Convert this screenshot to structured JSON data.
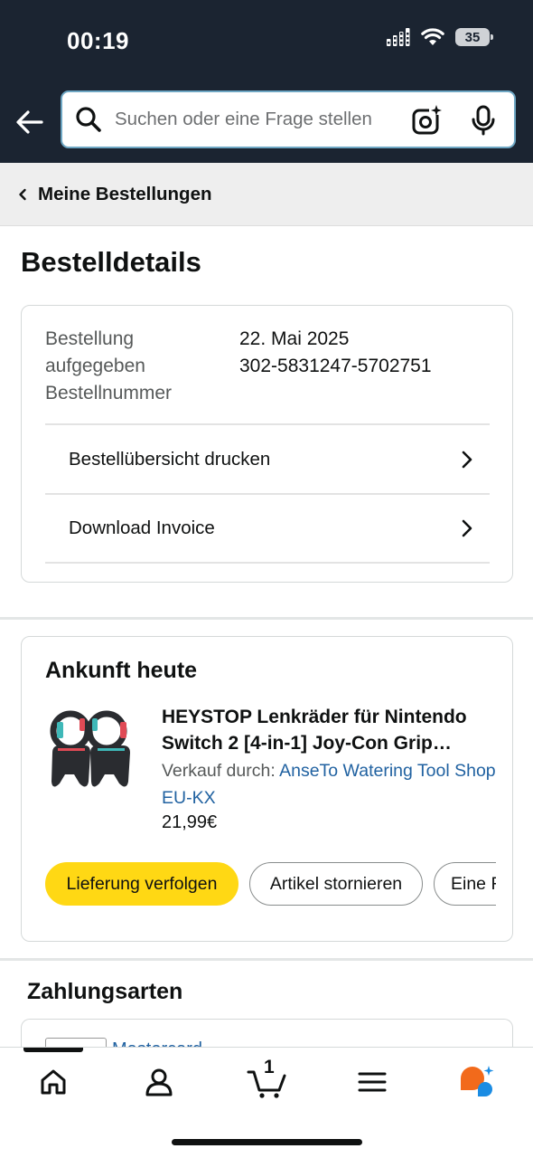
{
  "status_bar": {
    "time": "00:19",
    "battery": "35"
  },
  "search": {
    "placeholder": "Suchen oder eine Frage stellen"
  },
  "breadcrumb": {
    "label": "Meine Bestellungen"
  },
  "page_title": "Bestelldetails",
  "order_info": {
    "label_lines": [
      "Bestellung",
      "aufgegeben",
      "Bestellnummer"
    ],
    "order_date": "22. Mai 2025",
    "order_number": "302-5831247-5702751",
    "print_summary": "Bestellübersicht drucken",
    "download_invoice": "Download Invoice"
  },
  "shipment": {
    "heading": "Ankunft heute",
    "product_title_line1": "HEYSTOP Lenkräder für Nintendo",
    "product_title_line2": "Switch 2 [4-in-1] Joy-Con Grip…",
    "sold_by_prefix": "Verkauf durch:",
    "seller_name": "AnseTo Watering Tool Shop EU-KX",
    "price": "21,99€",
    "buttons": {
      "track": "Lieferung verfolgen",
      "cancel": "Artikel stornieren",
      "more": "Eine F"
    }
  },
  "payments": {
    "heading": "Zahlungsarten",
    "method_partial": "Mastercard …"
  },
  "bottom_nav": {
    "cart_count": "1"
  },
  "colors": {
    "header_bg": "#1b2431",
    "primary_button": "#ffd814",
    "link": "#2162a1",
    "assistant_orange": "#f26a1b",
    "assistant_blue": "#1b8ce3"
  }
}
